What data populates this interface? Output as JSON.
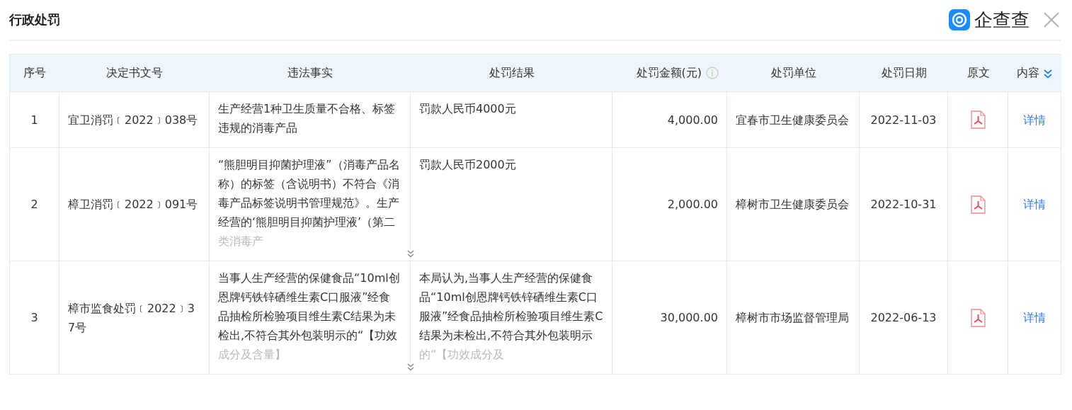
{
  "title": "行政处罚",
  "brand": {
    "name": "企查查"
  },
  "table": {
    "columns": [
      {
        "label": "序号"
      },
      {
        "label": "决定书文号"
      },
      {
        "label": "违法事实"
      },
      {
        "label": "处罚结果"
      },
      {
        "label": "处罚金额(元)",
        "info": true
      },
      {
        "label": "处罚单位"
      },
      {
        "label": "处罚日期"
      },
      {
        "label": "原文"
      },
      {
        "label": "内容"
      }
    ],
    "rows": [
      {
        "index": "1",
        "doc_no": "宜卫消罚﹝2022﹞038号",
        "facts": "生产经营1种卫生质量不合格、标签违规的消毒产品",
        "facts_truncated": false,
        "result": "罚款人民币4000元",
        "result_truncated": false,
        "amount": "4,000.00",
        "authority": "宜春市卫生健康委员会",
        "date": "2022-11-03",
        "detail": "详情"
      },
      {
        "index": "2",
        "doc_no": "樟卫消罚﹝2022﹞091号",
        "facts": "“熊胆明目抑菌护理液”（消毒产品名称）的标签（含说明书）不符合《消毒产品标签说明书管理规范》。生产经营的‘熊胆明目抑菌护理液’（第二类消毒产",
        "facts_truncated": true,
        "result": "罚款人民币2000元",
        "result_truncated": false,
        "amount": "2,000.00",
        "authority": "樟树市卫生健康委员会",
        "date": "2022-10-31",
        "detail": "详情"
      },
      {
        "index": "3",
        "doc_no": "樟市监食处罚﹝2022﹞37号",
        "facts": "当事人生产经营的保健食品“10ml创恩牌钙铁锌硒维生素C口服液”经食品抽检所检验项目维生素C结果为未检出,不符合其外包装明示的“【功效成分及含量】",
        "facts_truncated": true,
        "result": "本局认为,当事人生产经营的保健食品“10ml创恩牌钙铁锌硒维生素C口服液”经食品抽检所检验项目维生素C结果为未检出,不符合其外包装明示的“【功效成分及",
        "result_truncated": true,
        "amount": "30,000.00",
        "authority": "樟树市市场监督管理局",
        "date": "2022-06-13",
        "detail": "详情"
      }
    ]
  }
}
